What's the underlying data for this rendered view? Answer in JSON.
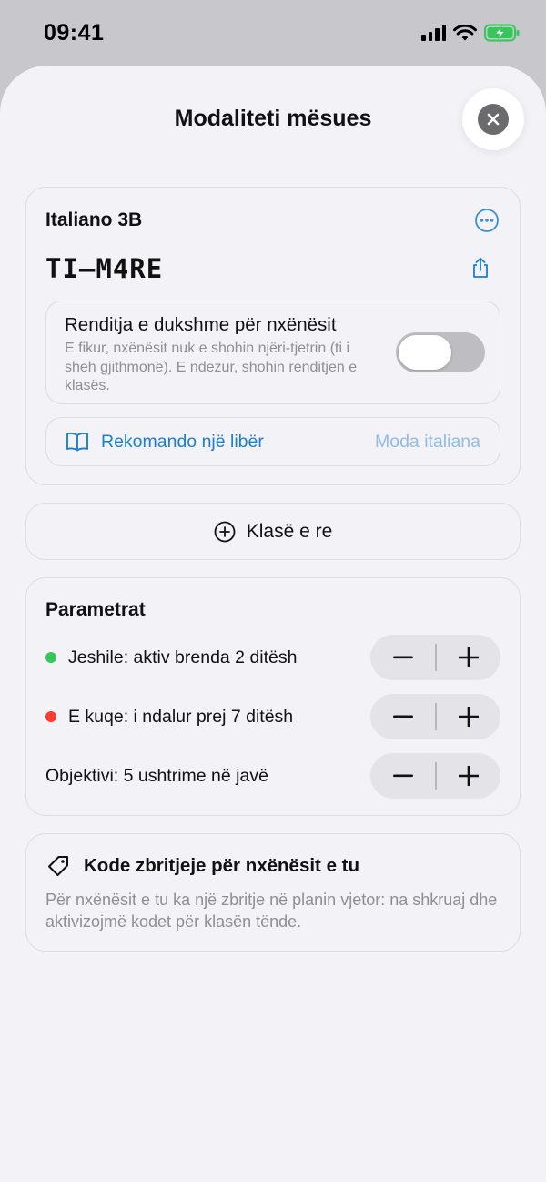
{
  "status_bar": {
    "time": "09:41"
  },
  "sheet": {
    "title": "Modaliteti mësues"
  },
  "class_card": {
    "class_name": "Italiano 3B",
    "class_code": "TI–M4RE",
    "visible_ranking": {
      "title": "Renditja e dukshme për nxënësit",
      "description": "E fikur, nxënësit nuk e shohin njëri-tjetrin (ti i sheh gjithmonë). E ndezur, shohin renditjen e klasës.",
      "enabled": false
    },
    "recommend": {
      "label": "Rekomando një libër",
      "value": "Moda italiana"
    }
  },
  "new_class": {
    "label": "Klasë e re"
  },
  "parameters": {
    "title": "Parametrat",
    "rows": [
      {
        "label": "Jeshile: aktiv brenda 2 ditësh",
        "dot_color": "#34c759"
      },
      {
        "label": "E kuqe: i ndalur prej 7 ditësh",
        "dot_color": "#ff3b30"
      },
      {
        "label": "Objektivi: 5 ushtrime në javë"
      }
    ]
  },
  "discount": {
    "title": "Kode zbritjeje për nxënësit e tu",
    "description": "Për nxënësit e tu ka një zbritje në planin vjetor: na shkruaj dhe aktivizojmë kodet për klasën tënde."
  },
  "colors": {
    "accent": "#1a7fd1",
    "accent_light": "#8fbde6",
    "background": "#f2f2f7"
  }
}
